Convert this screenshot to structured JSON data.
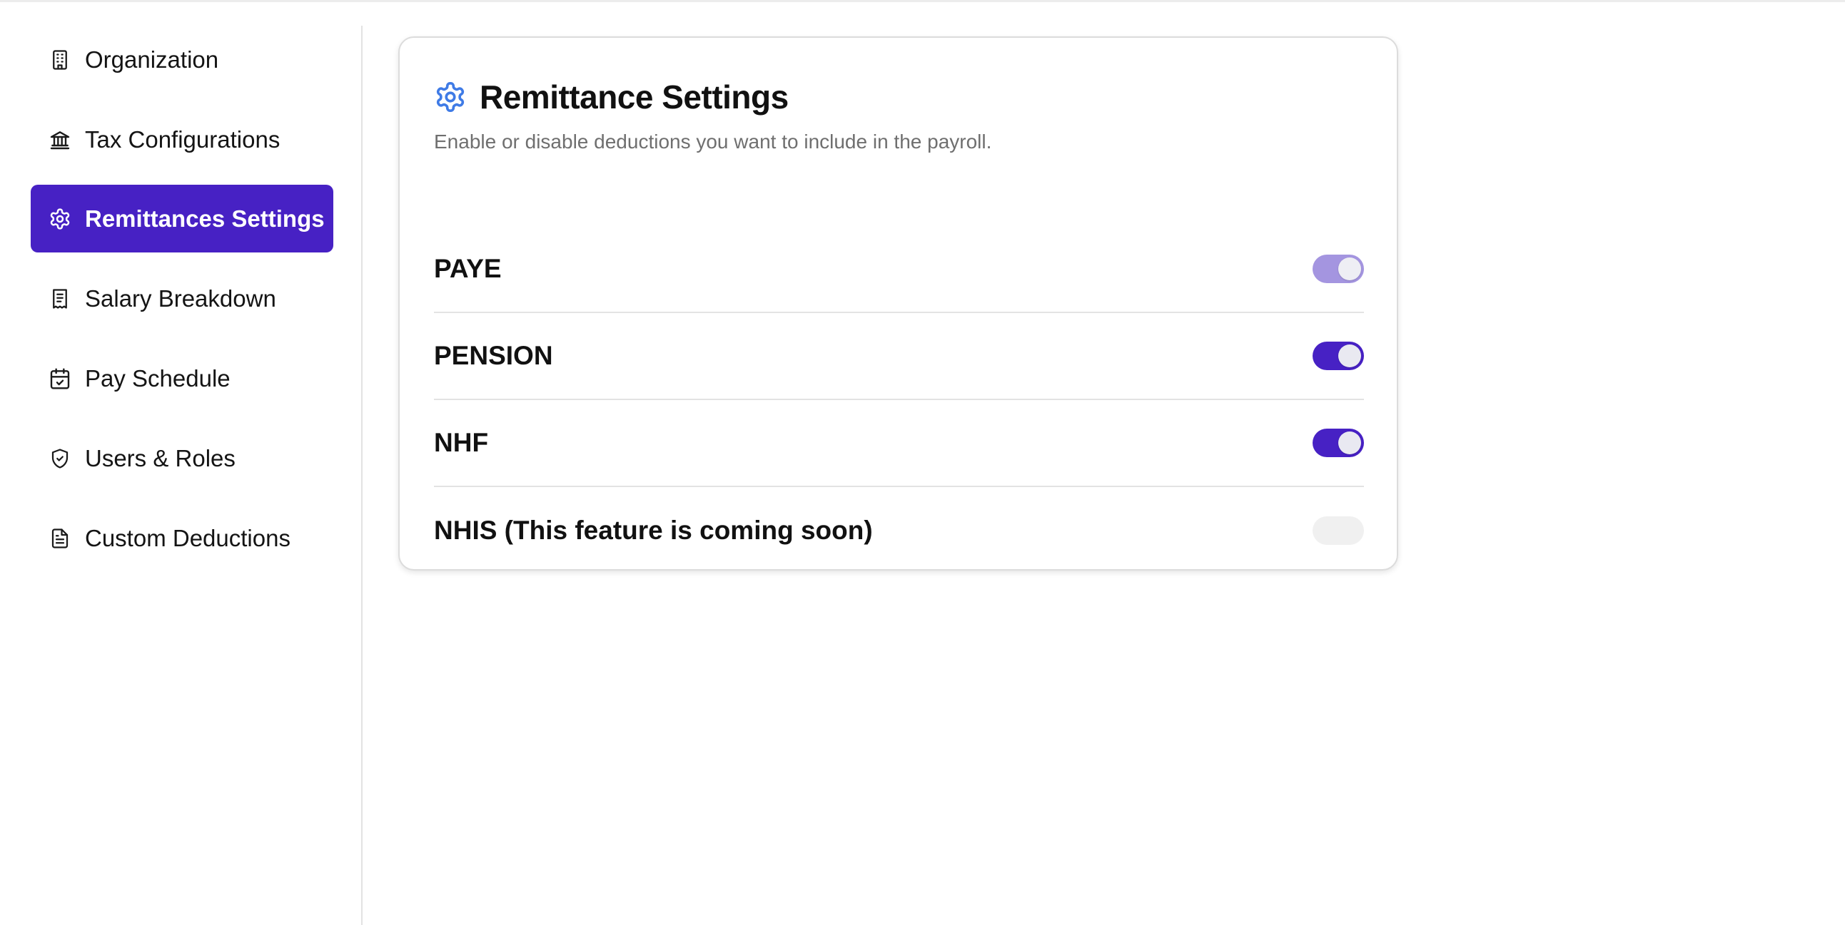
{
  "sidebar": {
    "items": [
      {
        "label": "Organization",
        "icon": "building-icon",
        "active": false
      },
      {
        "label": "Tax Configurations",
        "icon": "bank-icon",
        "active": false
      },
      {
        "label": "Remittances Settings",
        "icon": "gear-icon",
        "active": true
      },
      {
        "label": "Salary Breakdown",
        "icon": "receipt-icon",
        "active": false
      },
      {
        "label": "Pay Schedule",
        "icon": "calendar-check-icon",
        "active": false
      },
      {
        "label": "Users & Roles",
        "icon": "shield-check-icon",
        "active": false
      },
      {
        "label": "Custom Deductions",
        "icon": "document-icon",
        "active": false
      }
    ]
  },
  "card": {
    "icon": "gear-icon",
    "title": "Remittance Settings",
    "subtitle": "Enable or disable deductions you want to include in the payroll.",
    "rows": [
      {
        "label": "PAYE",
        "toggle": "on",
        "disabled": true
      },
      {
        "label": "PENSION",
        "toggle": "on",
        "disabled": false
      },
      {
        "label": "NHF",
        "toggle": "on",
        "disabled": false
      },
      {
        "label": "NHIS (This feature is coming soon)",
        "toggle": "off",
        "disabled": true
      }
    ]
  },
  "colors": {
    "accent": "#4721c4",
    "accent_faded": "#a495e0",
    "title_icon": "#3f7be6"
  }
}
